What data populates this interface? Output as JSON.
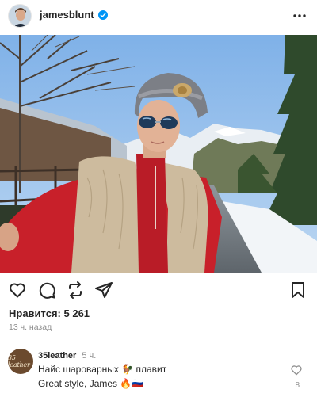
{
  "post": {
    "username": "jamesblunt",
    "likes_label": "Нравится: 5 261",
    "time_ago": "13 ч. назад"
  },
  "icons": {
    "verified": "verified-badge-icon",
    "more": "more-options-icon",
    "like": "heart-icon",
    "comment": "comment-icon",
    "repost": "repost-icon",
    "share": "send-icon",
    "save": "bookmark-icon"
  },
  "colors": {
    "verified_blue": "#0095f6",
    "text": "#262626",
    "muted": "#8e8e8e"
  },
  "comment": {
    "username": "35leather",
    "time_ago": "5 ч.",
    "avatar_text": "35 leather",
    "line1": "Найс шароварных 🐓 плавит",
    "line2": "Great style, James 🔥🇷🇺",
    "likes": "8"
  }
}
